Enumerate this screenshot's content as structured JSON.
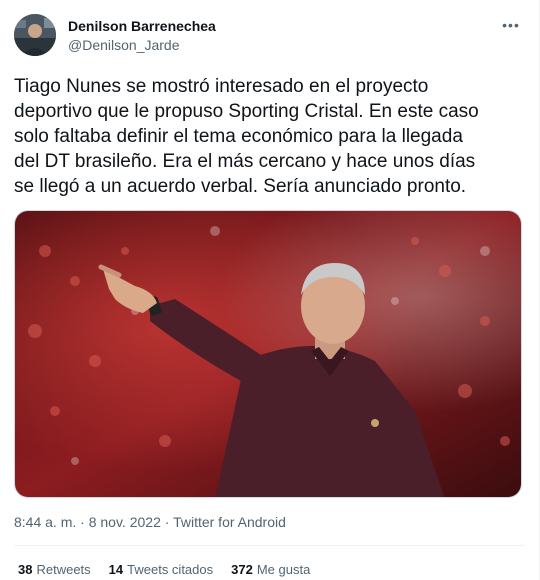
{
  "author": {
    "display_name": "Denilson Barrenechea",
    "handle": "@Denilson_Jarde"
  },
  "menu": {
    "more_label": "•••"
  },
  "tweet": {
    "text": "Tiago Nunes se mostró interesado en el proyecto\ndeportivo que le propuso Sporting Cristal. En este caso\nsolo faltaba definir el tema económico para la llegada\ndel DT brasileño. Era el más cercano y hace unos días\nse llegó a un acuerdo verbal. Sería anunciado pronto.",
    "time": "8:44 a. m.",
    "date": "8 nov. 2022",
    "source": "Twitter for Android",
    "separator": "·"
  },
  "stats": {
    "retweets_count": "38",
    "retweets_label": "Retweets",
    "quotes_count": "14",
    "quotes_label": "Tweets citados",
    "likes_count": "372",
    "likes_label": "Me gusta"
  },
  "colors": {
    "text_primary": "#0f1419",
    "text_secondary": "#536471",
    "divider": "#eff3f4",
    "shirt": "#4a1f2a",
    "crowd_red": "#b3262a"
  }
}
